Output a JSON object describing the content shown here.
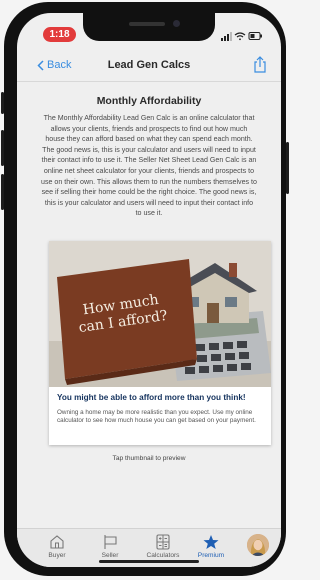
{
  "status": {
    "time": "1:18"
  },
  "nav": {
    "back_label": "Back",
    "title": "Lead Gen Calcs"
  },
  "section": {
    "title": "Monthly Affordability",
    "description": "The Monthly Affordability Lead Gen Calc is an online calculator that allows your clients, friends and prospects to find out how much house they can afford based on what they can spend each month. The good news is, this is your calculator and users will need to input their contact info to use it. The Seller Net Sheet Lead Gen Calc is an online net sheet calculator for your clients, friends and prospects to use on their own. This allows them to run the numbers themselves to see if selling their home could be the right choice. The good news is, this is your calculator and users will need to input their contact info to use it."
  },
  "thumbnail": {
    "sign_line1": "How much",
    "sign_line2": "can I afford?",
    "caption_title": "You might be able to afford more than you think!",
    "caption_body": "Owning a home may be more realistic than you expect. Use my online calculator to see how much house you can get based on your payment."
  },
  "hint": "Tap thumbnail to preview",
  "tabs": [
    {
      "label": "Buyer",
      "icon": "house-icon"
    },
    {
      "label": "Seller",
      "icon": "sign-icon"
    },
    {
      "label": "Calculators",
      "icon": "calculator-icon"
    },
    {
      "label": "Premium",
      "icon": "star-icon",
      "active": true
    }
  ],
  "colors": {
    "accent": "#3a8de0",
    "active_tab": "#1f5fb4",
    "time_pill": "#e23b3b",
    "caption_title": "#15335e"
  }
}
